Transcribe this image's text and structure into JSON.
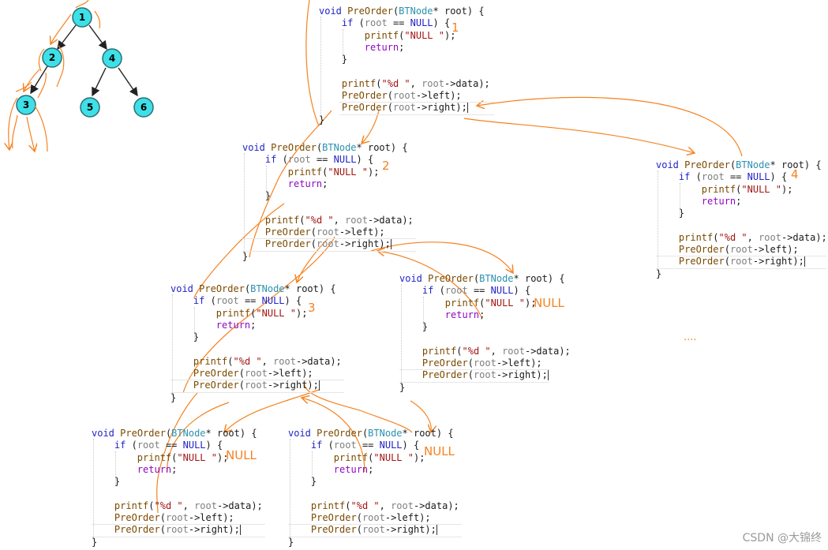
{
  "tree": {
    "nodes": [
      {
        "id": "n1",
        "label": "1"
      },
      {
        "id": "n2",
        "label": "2"
      },
      {
        "id": "n4",
        "label": "4"
      },
      {
        "id": "n3",
        "label": "3"
      },
      {
        "id": "n5",
        "label": "5"
      },
      {
        "id": "n6",
        "label": "6"
      }
    ],
    "edges": [
      [
        "n1",
        "n2"
      ],
      [
        "n1",
        "n4"
      ],
      [
        "n2",
        "n3"
      ],
      [
        "n4",
        "n5"
      ],
      [
        "n4",
        "n6"
      ]
    ],
    "node_fill": "#3ee0e8",
    "node_stroke": "#2a6f74"
  },
  "code": {
    "l1_void": "void",
    "l1_fn": "PreOrder",
    "l1_type": "BTNode",
    "l1_param": "* root) {",
    "l2_if": "if",
    "l2_cond_a": " (",
    "l2_root": "root",
    "l2_eq": " == ",
    "l2_null": "NULL",
    "l2_end": ") {",
    "l3_printf": "printf",
    "l3_str": "\"NULL \"",
    "l3_end": ");",
    "l4_return": "return",
    "l4_end": ";",
    "l5_close": "}",
    "l7_printf": "printf",
    "l7_str": "\"%d \"",
    "l7_mid": ", ",
    "l7_root": "root",
    "l7_arrow": "->data);",
    "l8_fn": "PreOrder",
    "l8_open": "(",
    "l8_root": "root",
    "l8_rest": "->left);",
    "l9_fn": "PreOrder",
    "l9_open": "(",
    "l9_root": "root",
    "l9_rest": "->right);",
    "l10_close": "}"
  },
  "annotations": {
    "block_a": "1",
    "block_b": "2",
    "block_c": "4",
    "block_d": "3",
    "block_e": "NULL",
    "block_f": "NULL",
    "block_g": "NULL",
    "ellipsis": "....",
    "color": "#f58220"
  },
  "watermark": "CSDN @大锦终"
}
